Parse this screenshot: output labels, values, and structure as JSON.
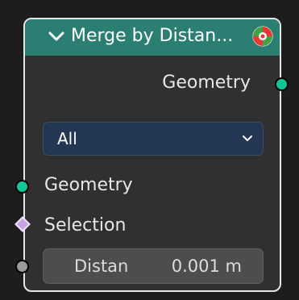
{
  "node": {
    "title": "Merge by Distan...",
    "header_color": "#2b7f72",
    "outputs": [
      {
        "label": "Geometry",
        "socket_color": "#12c69a"
      }
    ],
    "mode_dropdown": {
      "value": "All"
    },
    "inputs": {
      "geometry": {
        "label": "Geometry",
        "socket_color": "#12c69a"
      },
      "selection": {
        "label": "Selection",
        "socket_color": "#c9a3e3"
      },
      "distance": {
        "label": "Distan",
        "value": "0.001 m",
        "socket_color": "#9a9a9a"
      }
    }
  },
  "icons": {
    "collapse": "chevron-down-icon",
    "gizmo": "target-gizmo-icon",
    "dropdown": "chevron-down-icon"
  }
}
